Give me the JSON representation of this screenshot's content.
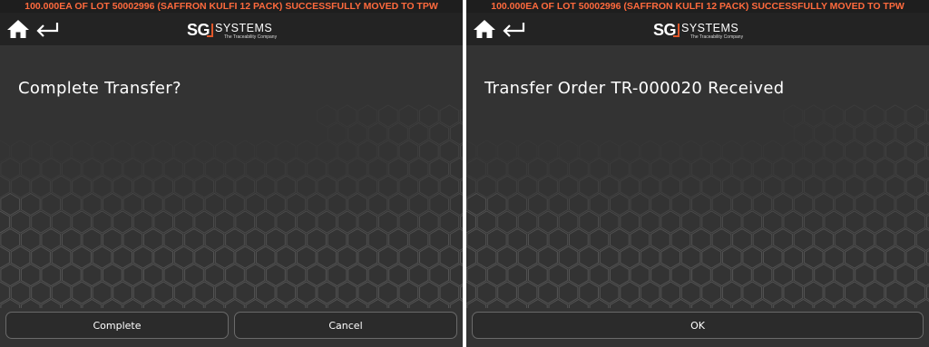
{
  "banner_text": "100.000EA OF LOT 50002996 (SAFFRON KULFI 12 PACK) SUCCESSFULLY MOVED TO TPW",
  "icons": {
    "home": "home-icon",
    "back": "back-arrow-icon"
  },
  "logo": {
    "brand": "SG",
    "name": "SYSTEMS",
    "tagline": "The Traceability Company",
    "accent": "#e0572a"
  },
  "colors": {
    "banner_text": "#ff6a3d",
    "background": "#333333",
    "topbar": "#232323"
  },
  "left_screen": {
    "prompt": "Complete Transfer?",
    "buttons": {
      "complete": "Complete",
      "cancel": "Cancel"
    }
  },
  "right_screen": {
    "message": "Transfer Order TR-000020 Received",
    "buttons": {
      "ok": "OK"
    }
  }
}
